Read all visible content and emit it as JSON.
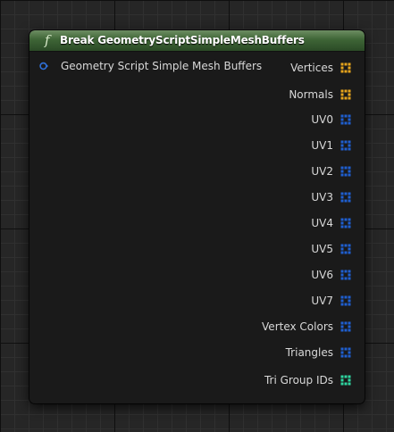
{
  "node": {
    "icon": "function-icon",
    "icon_glyph": "f",
    "title": "Break GeometryScriptSimpleMeshBuffers",
    "header_color": "#3e6536",
    "input": {
      "label": "Geometry Script Simple Mesh Buffers",
      "pin_color": "#2f6fd6"
    },
    "outputs": [
      {
        "label": "Vertices",
        "pin_color": "#e6a41c",
        "icon": "struct-array-pin-icon"
      },
      {
        "label": "Normals",
        "pin_color": "#e6a41c",
        "icon": "struct-array-pin-icon"
      },
      {
        "label": "UV0",
        "pin_color": "#1f5fd0",
        "icon": "struct-array-pin-icon"
      },
      {
        "label": "UV1",
        "pin_color": "#1f5fd0",
        "icon": "struct-array-pin-icon"
      },
      {
        "label": "UV2",
        "pin_color": "#1f5fd0",
        "icon": "struct-array-pin-icon"
      },
      {
        "label": "UV3",
        "pin_color": "#1f5fd0",
        "icon": "struct-array-pin-icon"
      },
      {
        "label": "UV4",
        "pin_color": "#1f5fd0",
        "icon": "struct-array-pin-icon"
      },
      {
        "label": "UV5",
        "pin_color": "#1f5fd0",
        "icon": "struct-array-pin-icon"
      },
      {
        "label": "UV6",
        "pin_color": "#1f5fd0",
        "icon": "struct-array-pin-icon"
      },
      {
        "label": "UV7",
        "pin_color": "#1f5fd0",
        "icon": "struct-array-pin-icon"
      },
      {
        "label": "Vertex Colors",
        "pin_color": "#1f5fd0",
        "icon": "struct-array-pin-icon"
      },
      {
        "label": "Triangles",
        "pin_color": "#1f5fd0",
        "icon": "struct-array-pin-icon"
      },
      {
        "label": "Tri Group IDs",
        "pin_color": "#2fd6a0",
        "icon": "int-array-pin-icon"
      }
    ]
  }
}
